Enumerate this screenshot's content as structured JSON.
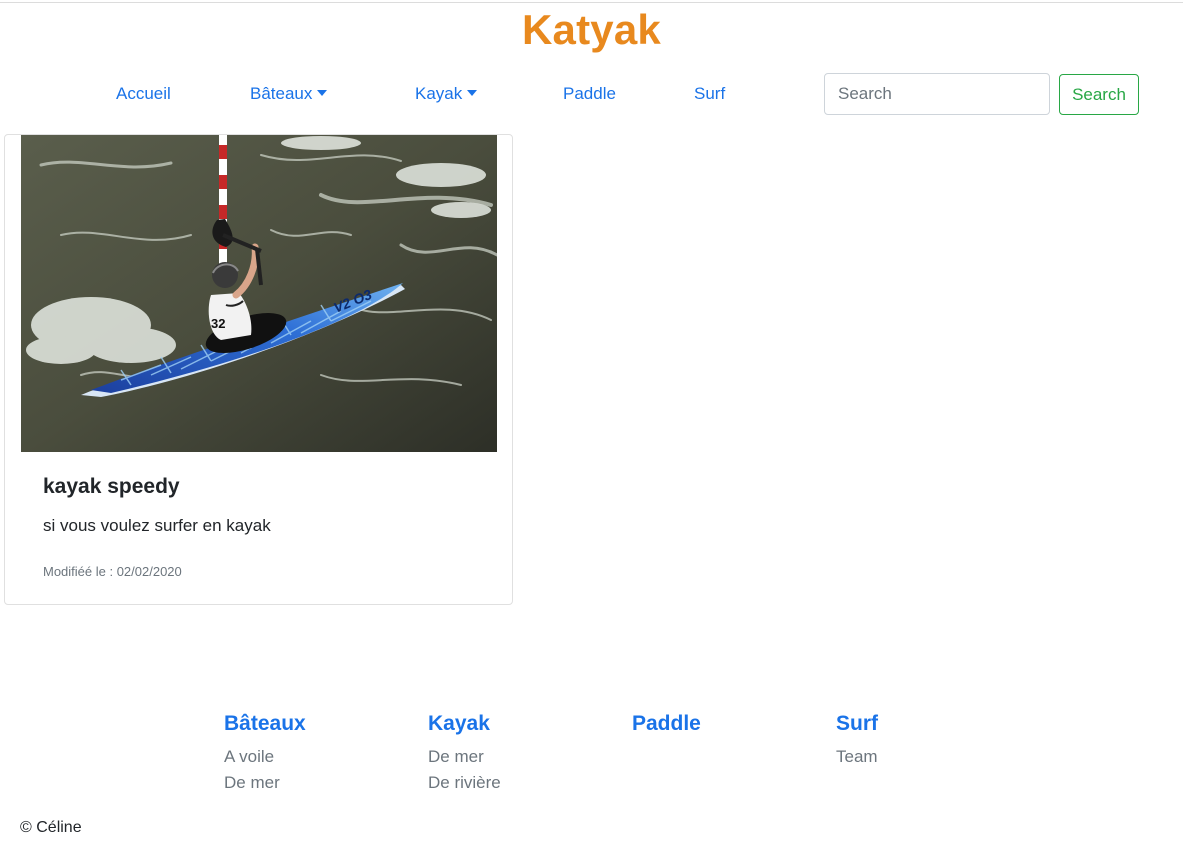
{
  "header": {
    "brand": "Katyak"
  },
  "nav": {
    "accueil": "Accueil",
    "bateaux": "Bâteaux",
    "kayak": "Kayak",
    "paddle": "Paddle",
    "surf": "Surf"
  },
  "search": {
    "placeholder": "Search",
    "button_label": "Search"
  },
  "card": {
    "title": "kayak speedy",
    "text": "si vous voulez surfer en kayak",
    "modified": "Modifiéé le : 02/02/2020",
    "bib_number": "32"
  },
  "footer": {
    "columns": [
      {
        "heading": "Bâteaux",
        "links": [
          "A voile",
          "De mer"
        ]
      },
      {
        "heading": "Kayak",
        "links": [
          "De mer",
          "De rivière"
        ]
      },
      {
        "heading": "Paddle",
        "links": []
      },
      {
        "heading": "Surf",
        "links": [
          "Team"
        ]
      }
    ],
    "copyright": "© Céline"
  },
  "colors": {
    "brand": "#e8891e",
    "link": "#1a73e8",
    "success": "#28a745",
    "muted": "#6c757d"
  }
}
